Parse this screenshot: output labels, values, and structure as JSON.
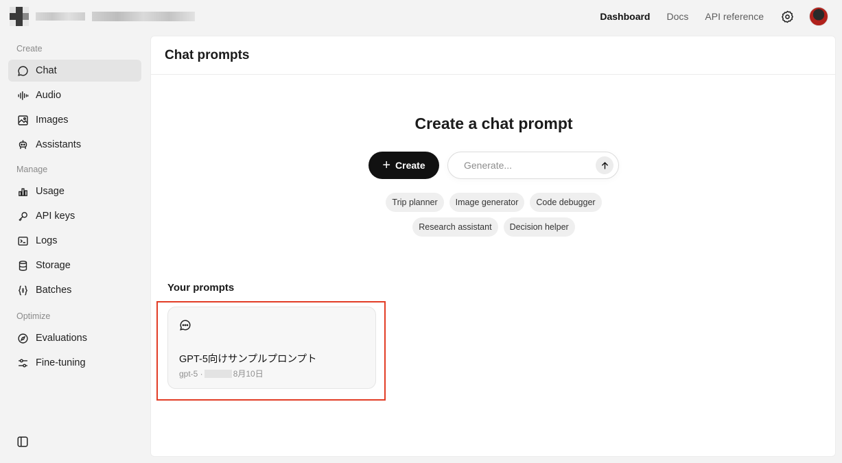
{
  "topnav": {
    "dashboard": "Dashboard",
    "docs": "Docs",
    "api_reference": "API reference"
  },
  "sidebar": {
    "sections": [
      {
        "title": "Create",
        "items": [
          {
            "label": "Chat",
            "icon": "chat-bubble-icon",
            "active": true
          },
          {
            "label": "Audio",
            "icon": "audio-waveform-icon"
          },
          {
            "label": "Images",
            "icon": "image-icon"
          },
          {
            "label": "Assistants",
            "icon": "robot-icon"
          }
        ]
      },
      {
        "title": "Manage",
        "items": [
          {
            "label": "Usage",
            "icon": "bar-chart-icon"
          },
          {
            "label": "API keys",
            "icon": "key-icon"
          },
          {
            "label": "Logs",
            "icon": "terminal-icon"
          },
          {
            "label": "Storage",
            "icon": "database-icon"
          },
          {
            "label": "Batches",
            "icon": "braces-icon"
          }
        ]
      },
      {
        "title": "Optimize",
        "items": [
          {
            "label": "Evaluations",
            "icon": "compass-icon"
          },
          {
            "label": "Fine-tuning",
            "icon": "sliders-icon"
          }
        ]
      }
    ]
  },
  "main": {
    "title": "Chat prompts",
    "create_heading": "Create a chat prompt",
    "create_label": "Create",
    "generate_placeholder": "Generate...",
    "chips_row1": [
      "Trip planner",
      "Image generator",
      "Code debugger"
    ],
    "chips_row2": [
      "Research assistant",
      "Decision helper"
    ],
    "your_prompts": "Your prompts",
    "prompt_card": {
      "title": "GPT-5向けサンプルプロンプト",
      "model": "gpt-5 ·",
      "date": "8月10日"
    }
  },
  "colors": {
    "accent": "#111111",
    "highlight": "#e23c25",
    "active_nav": "#e4e4e4"
  }
}
